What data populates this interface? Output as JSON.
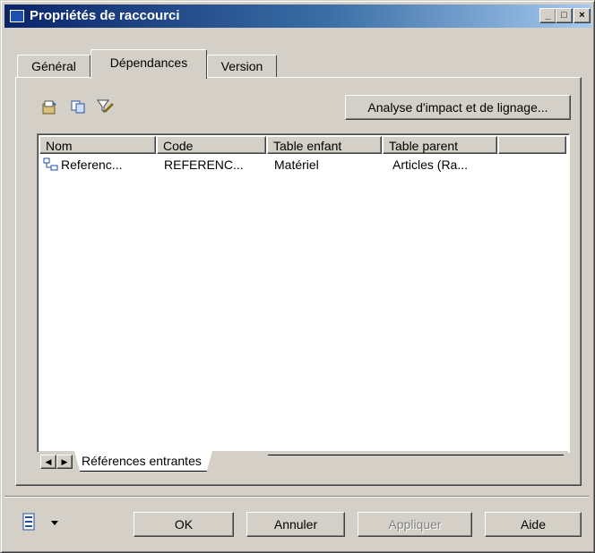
{
  "window": {
    "title": "Propriétés de raccourci"
  },
  "titlebar_buttons": {
    "minimize": "_",
    "maximize": "□",
    "close": "×"
  },
  "tabs": [
    {
      "label": "Général",
      "active": false
    },
    {
      "label": "Dépendances",
      "active": true
    },
    {
      "label": "Version",
      "active": false
    }
  ],
  "toolbar": {
    "icons": [
      "properties-icon",
      "copy-icon",
      "filter-icon"
    ],
    "impact_button": "Analyse d'impact et de lignage..."
  },
  "list": {
    "columns": [
      "Nom",
      "Code",
      "Table enfant",
      "Table parent"
    ],
    "rows": [
      {
        "icon": "reference-icon",
        "nom": "Referenc...",
        "code": "REFERENC...",
        "table_enfant": "Matériel",
        "table_parent": "Articles (Ra..."
      }
    ]
  },
  "subtabs": {
    "active": "Références entrantes"
  },
  "footer": {
    "ok": "OK",
    "annuler": "Annuler",
    "appliquer": "Appliquer",
    "aide": "Aide",
    "appliquer_enabled": false
  }
}
